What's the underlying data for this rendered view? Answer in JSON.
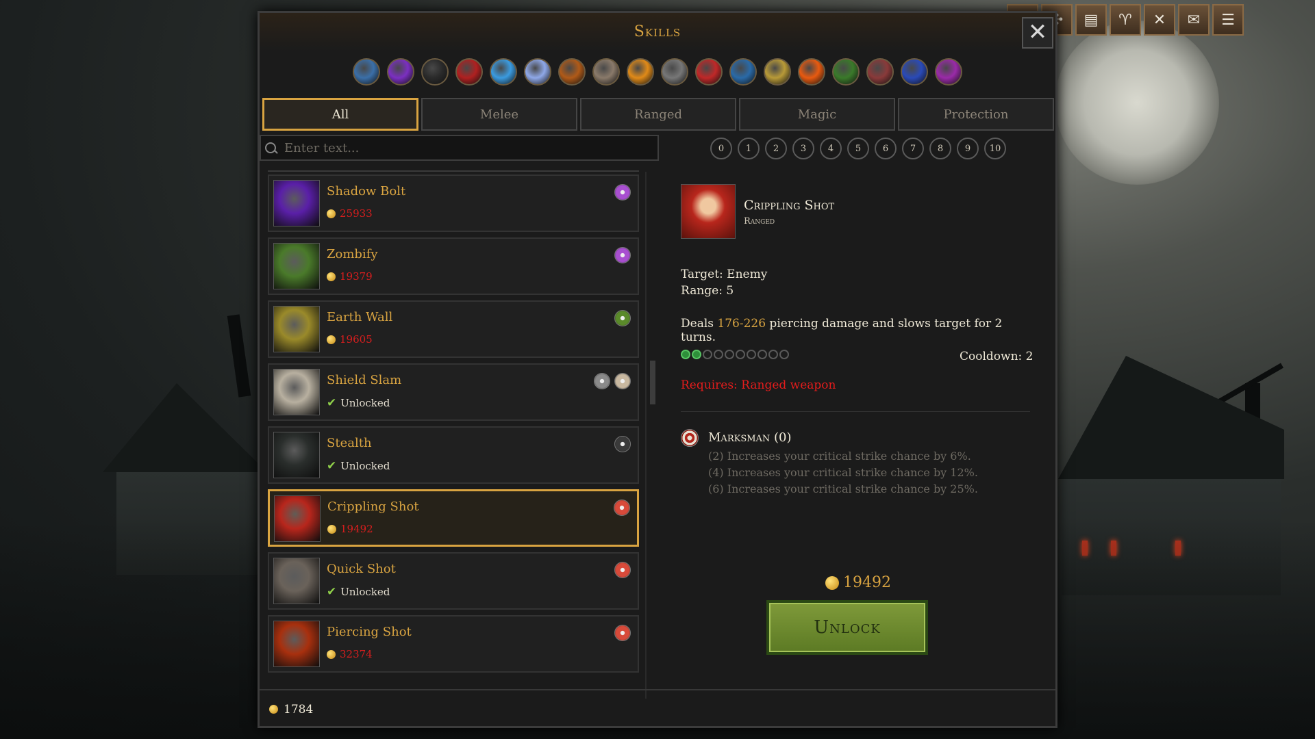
{
  "window": {
    "title": "Skills",
    "close_label": "✕"
  },
  "toolbar": {
    "buttons": [
      {
        "name": "plus",
        "glyph": "+"
      },
      {
        "name": "puzzle",
        "glyph": "✣"
      },
      {
        "name": "journal",
        "glyph": "▤"
      },
      {
        "name": "trophy",
        "glyph": "♈"
      },
      {
        "name": "crossed-swords",
        "glyph": "✕"
      },
      {
        "name": "mail",
        "glyph": "✉"
      },
      {
        "name": "menu",
        "glyph": "☰"
      }
    ]
  },
  "schools": [
    {
      "name": "school-1",
      "color": "#3b6fa8"
    },
    {
      "name": "school-2",
      "color": "#7b2fc1"
    },
    {
      "name": "school-3",
      "color": "#2a2a2a"
    },
    {
      "name": "school-4",
      "color": "#b02020"
    },
    {
      "name": "school-5",
      "color": "#3b9be0"
    },
    {
      "name": "school-6",
      "color": "#8fa8e8"
    },
    {
      "name": "school-7",
      "color": "#b05a18"
    },
    {
      "name": "school-8",
      "color": "#8a7a6a"
    },
    {
      "name": "school-9",
      "color": "#e08a18"
    },
    {
      "name": "school-10",
      "color": "#777777"
    },
    {
      "name": "school-11",
      "color": "#c02828"
    },
    {
      "name": "school-12",
      "color": "#2a6aa8"
    },
    {
      "name": "school-13",
      "color": "#b89a38"
    },
    {
      "name": "school-14",
      "color": "#e85a10"
    },
    {
      "name": "school-15",
      "color": "#3a7a2a"
    },
    {
      "name": "school-16",
      "color": "#8a3a3a"
    },
    {
      "name": "school-17",
      "color": "#2a4ab8"
    },
    {
      "name": "school-18",
      "color": "#9a2aa8"
    }
  ],
  "categories": [
    "All",
    "Melee",
    "Ranged",
    "Magic",
    "Protection"
  ],
  "search": {
    "placeholder": "Enter text..."
  },
  "levels": [
    "0",
    "1",
    "2",
    "3",
    "4",
    "5",
    "6",
    "7",
    "8",
    "9",
    "10"
  ],
  "skills": [
    {
      "name": "Shadow Bolt",
      "status": "price",
      "value": "25933",
      "icon_color": "#5a1fa8",
      "req_icons": [
        "#a84fd0"
      ]
    },
    {
      "name": "Zombify",
      "status": "price",
      "value": "19379",
      "icon_color": "#4a7a2a",
      "req_icons": [
        "#a84fd0"
      ]
    },
    {
      "name": "Earth Wall",
      "status": "price",
      "value": "19605",
      "icon_color": "#9a8a2a",
      "req_icons": [
        "#5a8a2a"
      ]
    },
    {
      "name": "Shield Slam",
      "status": "unlocked",
      "value": "Unlocked",
      "icon_color": "#b8b0a0",
      "req_icons": [
        "#8a8a8a",
        "#c8b8a0"
      ]
    },
    {
      "name": "Stealth",
      "status": "unlocked",
      "value": "Unlocked",
      "icon_color": "#2a2e2c",
      "req_icons": [
        "#3a3a3a"
      ]
    },
    {
      "name": "Crippling Shot",
      "status": "price",
      "value": "19492",
      "icon_color": "#b8261c",
      "req_icons": [
        "#d84a3a"
      ],
      "selected": true
    },
    {
      "name": "Quick Shot",
      "status": "unlocked",
      "value": "Unlocked",
      "icon_color": "#6a625a",
      "req_icons": [
        "#d84a3a"
      ]
    },
    {
      "name": "Piercing Shot",
      "status": "price",
      "value": "32374",
      "icon_color": "#a8300e",
      "req_icons": [
        "#d84a3a"
      ]
    }
  ],
  "detail": {
    "name": "Crippling Shot",
    "type": "Ranged",
    "target": "Target: Enemy",
    "range": "Range: 5",
    "desc_prefix": "Deals ",
    "desc_damage": "176-226",
    "desc_suffix": " piercing damage and slows target for 2 turns.",
    "cooldown_value": 2,
    "cooldown_max": 10,
    "cooldown_text": "Cooldown: 2",
    "requires": "Requires: Ranged weapon",
    "set_name": "Marksman (0)",
    "set_bonuses": [
      "(2) Increases your critical strike chance by 6%.",
      "(4) Increases your critical strike chance by 12%.",
      "(6) Increases your critical strike chance by 25%."
    ],
    "cost": "19492",
    "unlock_label": "Unlock"
  },
  "footer": {
    "gold": "1784"
  }
}
